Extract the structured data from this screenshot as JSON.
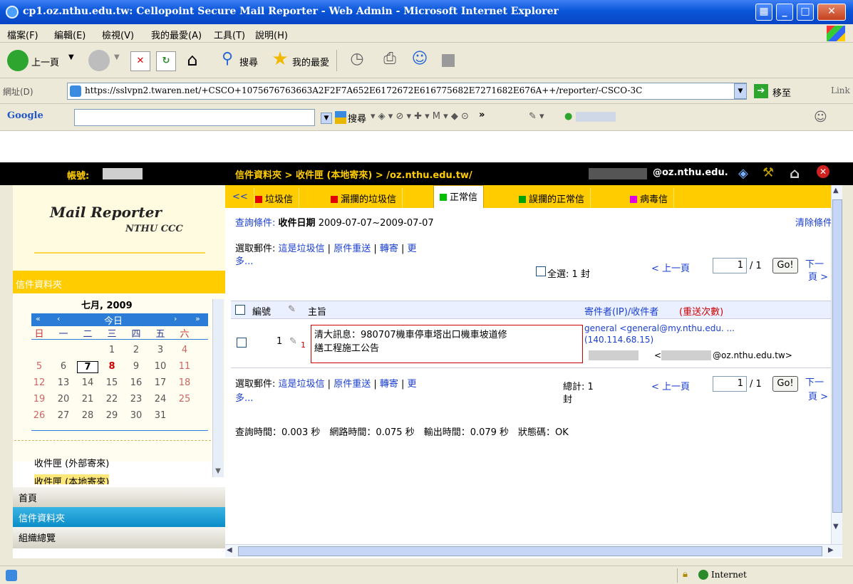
{
  "window": {
    "title": "cp1.oz.nthu.edu.tw: Cellopoint Secure Mail Reporter - Web Admin - Microsoft Internet Explorer"
  },
  "menu": [
    "檔案(F)",
    "編輯(E)",
    "檢視(V)",
    "我的最愛(A)",
    "工具(T)",
    "說明(H)"
  ],
  "toolbar": {
    "back": "上一頁",
    "search": "搜尋",
    "favorites": "我的最愛"
  },
  "address": {
    "label": "網址(D)",
    "url": "https://sslvpn2.twaren.net/+CSCO+1075676763663A2F2F7A652E6172672E616775682E7271682E676A++/reporter/-CSCO-3C",
    "go": "移至",
    "links": "Link"
  },
  "google": {
    "logo": "Google",
    "search": "搜尋"
  },
  "header": {
    "account_label": "帳號:",
    "breadcrumb": "信件資料夾 > 收件匣 (本地寄來) > /oz.nthu.edu.tw/",
    "email_domain": "@oz.nthu.edu."
  },
  "sidebar": {
    "logo_title": "Mail Reporter",
    "logo_sub": "NTHU CCC",
    "folder_header": "信件資料夾",
    "calendar": {
      "month": "七月, 2009",
      "today": "今日",
      "weekdays": [
        "日",
        "一",
        "二",
        "三",
        "四",
        "五",
        "六"
      ],
      "rows": [
        [
          "",
          "",
          "",
          "1",
          "2",
          "3",
          "4"
        ],
        [
          "5",
          "6",
          "7",
          "8",
          "9",
          "10",
          "11"
        ],
        [
          "12",
          "13",
          "14",
          "15",
          "16",
          "17",
          "18"
        ],
        [
          "19",
          "20",
          "21",
          "22",
          "23",
          "24",
          "25"
        ],
        [
          "26",
          "27",
          "28",
          "29",
          "30",
          "31",
          ""
        ]
      ]
    },
    "folders": [
      "收件匣 (外部寄來)",
      "收件匣 (本地寄來)"
    ],
    "nav": [
      "首頁",
      "信件資料夾",
      "組織總覽"
    ]
  },
  "tabs": {
    "prev": "<<",
    "items": [
      {
        "label": "垃圾信",
        "color": "#e00000"
      },
      {
        "label": "漏攔的垃圾信",
        "color": "#e00000"
      },
      {
        "label": "正常信",
        "color": "#00c000"
      },
      {
        "label": "誤攔的正常信",
        "color": "#00a000"
      },
      {
        "label": "病毒信",
        "color": "#e000e0"
      }
    ]
  },
  "query": {
    "label": "查詢條件:",
    "field": "收件日期",
    "range": "2009-07-07~2009-07-07",
    "clear": "清除條件"
  },
  "actions": {
    "label": "選取郵件:",
    "spam": "這是垃圾信",
    "resend": "原件重送",
    "forward": "轉寄",
    "more1": "更",
    "more2": "多..."
  },
  "selection": {
    "select_all": "全選: 1 封",
    "total_1": "總計: 1",
    "total_2": "封"
  },
  "pager": {
    "prev": "< 上一頁",
    "page": "1",
    "of": "/ 1",
    "go": "Go!",
    "next1": "下一",
    "next2": "頁 >"
  },
  "table": {
    "col_no": "編號",
    "col_subject": "主旨",
    "col_sender_a": "寄件者(IP)/收件者",
    "col_sender_b": "(重送次數)",
    "row": {
      "no": "1",
      "attach_count": "1",
      "subject_1": "清大訊息：980707機車停車塔出口機車坡道修",
      "subject_2": "繕工程施工公告",
      "sender": "general <general@my.nthu.edu. ...",
      "ip": "(140.114.68.15)",
      "recipient": "@oz.nthu.edu.tw>"
    }
  },
  "timing": "查詢時間：0.003 秒　網路時間：0.075 秒　輸出時間：0.079 秒　狀態碼：OK",
  "status": {
    "zone": "Internet"
  }
}
